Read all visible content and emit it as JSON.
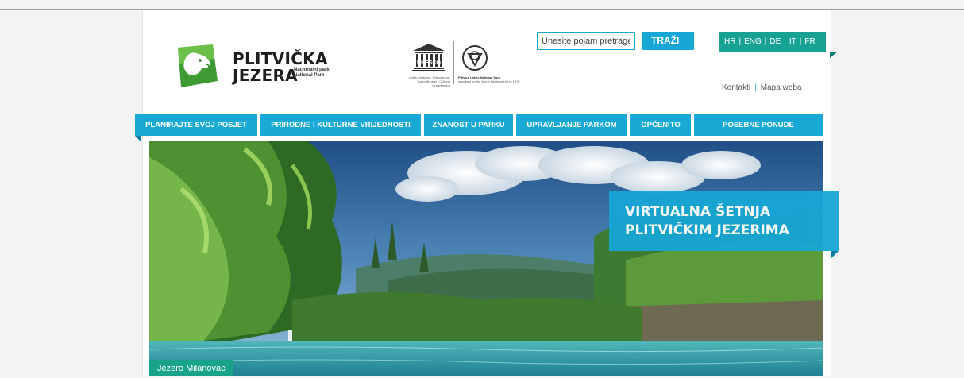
{
  "logo": {
    "title_line1": "PLITVIČKA",
    "title_line2": "JEZERA",
    "subtitle_line1": "Nacionalni park",
    "subtitle_line2": "National Park"
  },
  "unesco": {
    "wordmark": "UNESCO",
    "caption_left": "United Nations · Educational, Scientific and · Cultural Organization",
    "caption_right_title": "Plitvice Lakes National Park",
    "caption_right_rest": "inscribed on the World Heritage List in 1979"
  },
  "search": {
    "placeholder": "Unesite pojam pretrage",
    "button_label": "TRAŽI"
  },
  "languages": [
    "HR",
    "ENG",
    "DE",
    "IT",
    "FR"
  ],
  "utility_links": [
    "Kontakti",
    "Mapa weba"
  ],
  "nav": {
    "items": [
      "PLANIRAJTE SVOJ POSJET",
      "PRIRODNE I KULTURNE VRIJEDNOSTI",
      "ZNANOST U PARKU",
      "UPRAVLJANJE PARKOM",
      "OPĆENITO",
      "POSEBNE PONUDE"
    ]
  },
  "hero": {
    "banner_line1": "VIRTUALNA ŠETNJA",
    "banner_line2": "PLITVIČKIM JEZERIMA",
    "caption": "Jezero Milanovac"
  },
  "colors": {
    "accent_blue": "#18a9d4",
    "accent_teal": "#17a294",
    "caption_green": "#19a489",
    "logo_green": "#4fa73a"
  }
}
